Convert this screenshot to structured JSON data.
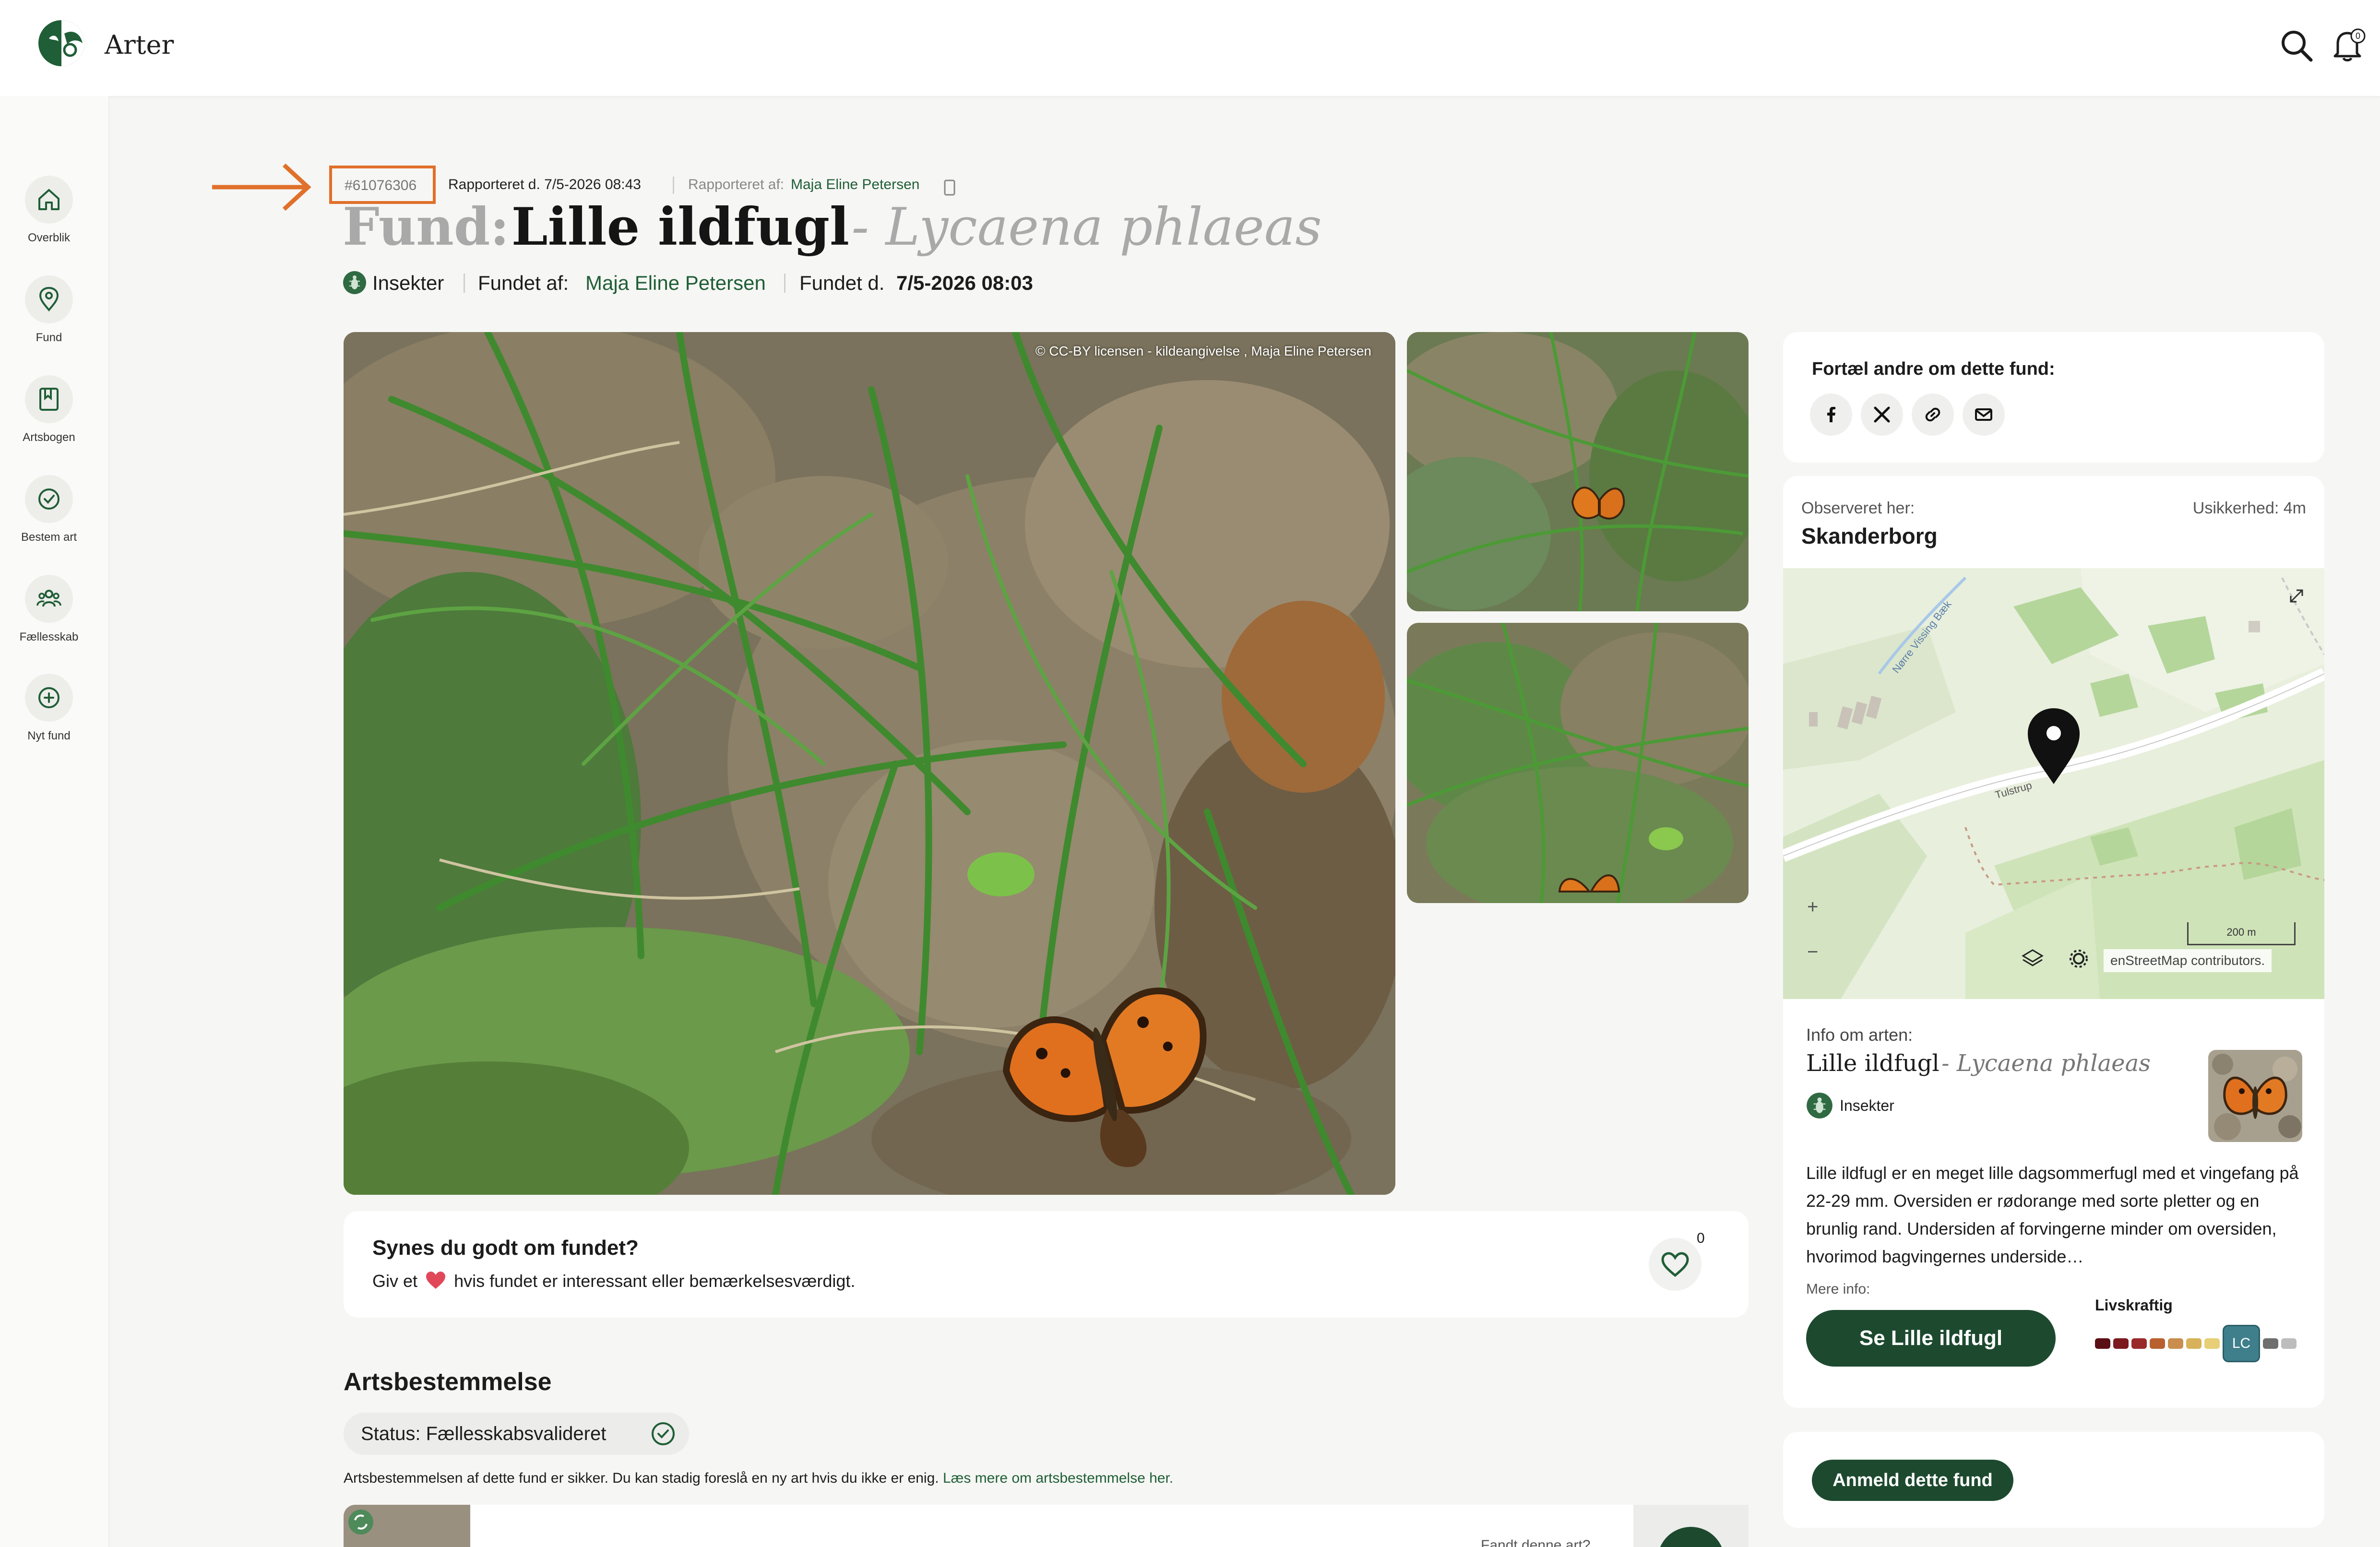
{
  "app": {
    "title": "Arter"
  },
  "sidebar": {
    "items": [
      {
        "label": "Overblik",
        "icon": "home-icon"
      },
      {
        "label": "Fund",
        "icon": "location-pin-icon"
      },
      {
        "label": "Artsbogen",
        "icon": "book-icon"
      },
      {
        "label": "Bestem art",
        "icon": "check-circle-icon"
      },
      {
        "label": "Fællesskab",
        "icon": "people-icon"
      },
      {
        "label": "Nyt fund",
        "icon": "plus-circle-icon"
      }
    ]
  },
  "header": {
    "id": "#61076306",
    "reported_at": "Rapporteret d. 7/5-2026 08:43",
    "reported_by_label": "Rapporteret af:",
    "reported_by_name": "Maja Eline Petersen",
    "title_prefix": "Fund:",
    "common_name": "Lille ildfugl",
    "latin_name": "- Lycaena phlaeas",
    "category": "Insekter",
    "found_by_label": "Fundet af:",
    "found_by_name": "Maja Eline Petersen",
    "found_date_label": "Fundet d.",
    "found_date": "7/5-2026 08:03"
  },
  "photos": {
    "credit": "© CC-BY licensen - kildeangivelse , Maja Eline Petersen"
  },
  "like_card": {
    "question": "Synes du godt om fundet?",
    "text_before": "Giv et",
    "text_after": "hvis fundet er interessant eller bemærkelsesværdigt.",
    "count": "0"
  },
  "determination": {
    "title": "Artsbestemmelse",
    "status": "Status: Fællesskabsvalideret",
    "info_text": "Artsbestemmelsen af dette fund er sikker. Du kan stadig foreslå en ny art hvis du ikke er enig.",
    "info_link": "Læs mere om artsbestemmelse her.",
    "peek_text": "Fandt denne art?"
  },
  "share": {
    "title": "Fortæl andre om dette fund:",
    "icons": [
      "facebook-icon",
      "x-icon",
      "link-icon",
      "mail-icon"
    ]
  },
  "location": {
    "observed_label": "Observeret her:",
    "place": "Skanderborg",
    "uncertainty": "Usikkerhed: 4m",
    "map": {
      "road_label_1": "Nørre Vissing Bæk",
      "road_label_2": "Tulstrup",
      "scale": "200 m",
      "attribution": "enStreetMap contributors.",
      "zoom_in": "+",
      "zoom_out": "−"
    }
  },
  "species_info": {
    "label": "Info om arten:",
    "common_name": "Lille ildfugl",
    "latin_name": "- Lycaena phlaeas",
    "category": "Insekter",
    "description": "Lille ildfugl er en meget lille dagsommerfugl med et vingefang på 22-29 mm. Oversiden er rødorange med sorte pletter og en brunlig rand. Undersiden af forvingerne minder om oversiden, hvorimod bagvingernes underside…",
    "more_info_label": "Mere info:",
    "button": "Se Lille ildfugl",
    "redlist_label": "Livskraftig",
    "redlist_code": "LC",
    "redlist_colors": [
      "#5a0f14",
      "#7a1a1e",
      "#9a2a2a",
      "#b8602e",
      "#c98e4e",
      "#d8b25a",
      "#e6cf76",
      "#3f7f8c",
      "#6f6f6f",
      "#bdbdbd"
    ]
  },
  "report": {
    "button": "Anmeld dette fund"
  }
}
